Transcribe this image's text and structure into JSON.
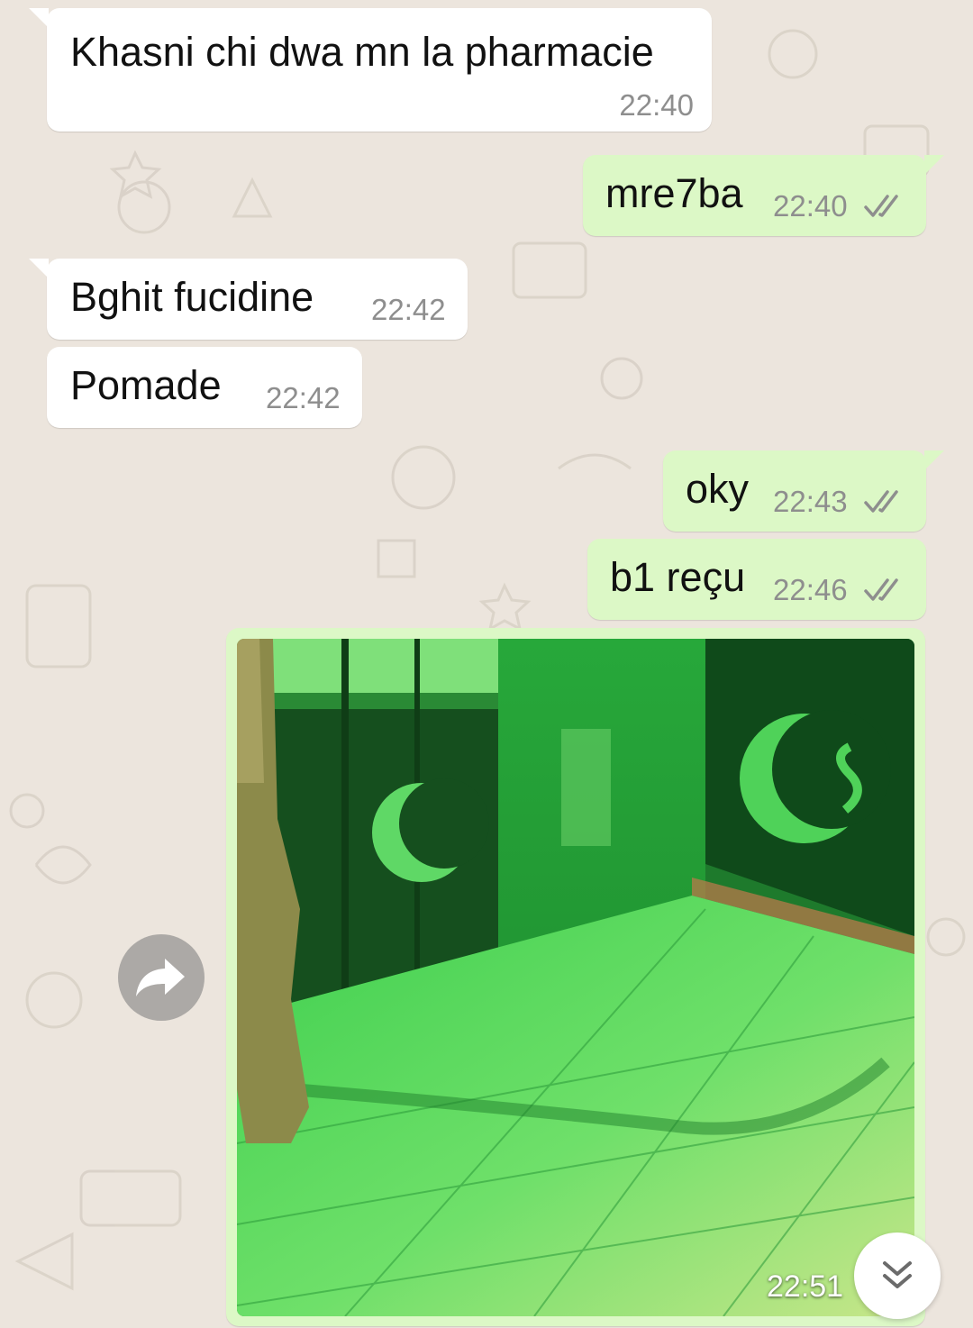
{
  "chat": {
    "messages": [
      {
        "direction": "incoming",
        "text": "Khasni chi dwa mn la pharmacie",
        "time": "22:40"
      },
      {
        "direction": "outgoing",
        "text": "mre7ba",
        "time": "22:40",
        "status": "read"
      },
      {
        "direction": "incoming",
        "text": "Bghit fucidine",
        "time": "22:42"
      },
      {
        "direction": "incoming",
        "text": "Pomade",
        "time": "22:42"
      },
      {
        "direction": "outgoing",
        "text": "oky",
        "time": "22:43",
        "status": "read"
      },
      {
        "direction": "outgoing",
        "text": "b1 reçu",
        "time": "22:46",
        "status": "read"
      },
      {
        "direction": "outgoing",
        "type": "image",
        "time": "22:51",
        "status": "read"
      }
    ]
  },
  "icons": {
    "read_ticks": "double-check-icon",
    "forward": "forward-icon",
    "scroll_down": "double-chevron-down-icon"
  },
  "colors": {
    "background": "#ece5dd",
    "incoming_bubble": "#ffffff",
    "outgoing_bubble": "#dcf8c6",
    "timestamp": "#8e8e8e",
    "read_ticks": "#8e8e8e"
  }
}
